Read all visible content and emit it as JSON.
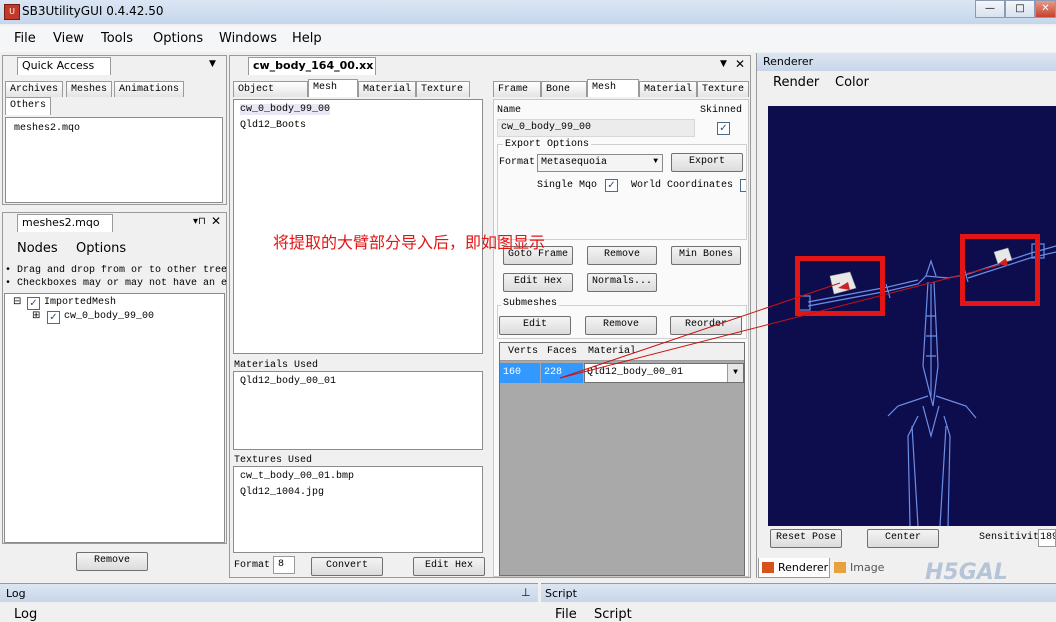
{
  "window": {
    "title": "SB3UtilityGUI 0.4.42.50"
  },
  "menu": {
    "items": [
      "File",
      "View",
      "Tools",
      "Options",
      "Windows",
      "Help"
    ]
  },
  "quick_access": {
    "title": "Quick Access",
    "tabs": [
      "Archives",
      "Meshes",
      "Animations",
      "Others"
    ],
    "items": [
      "meshes2.mqo"
    ],
    "remove_label": "Remove"
  },
  "mqo_panel": {
    "title": "meshes2.mqo",
    "menu": [
      "Nodes",
      "Options"
    ],
    "help_lines": [
      "• Drag and drop from or to other tree",
      "• Checkboxes may or may not have an e"
    ],
    "tree": [
      {
        "label": "ImportedMesh",
        "toggle": "⊟"
      },
      {
        "label": "cw_0_body_99_00",
        "toggle": "⊞"
      }
    ]
  },
  "doc_tab": {
    "title": "cw_body_164_00.xx"
  },
  "editor_tabs": [
    "Object Tree",
    "Mesh",
    "Material",
    "Texture"
  ],
  "mesh_list": [
    "cw_0_body_99_00",
    "Qld12_Boots"
  ],
  "materials_used": {
    "label": "Materials Used",
    "items": [
      "Qld12_body_00_01"
    ]
  },
  "textures_used": {
    "label": "Textures Used",
    "items": [
      "cw_t_body_00_01.bmp",
      "Qld12_1004.jpg"
    ]
  },
  "bottom_bar": {
    "format_label": "Format",
    "format_value": "8",
    "convert_label": "Convert",
    "edit_hex_label": "Edit Hex"
  },
  "props_tabs": [
    "Frame",
    "Bone",
    "Mesh",
    "Material",
    "Texture"
  ],
  "props": {
    "name_label": "Name",
    "name_value": "cw_0_body_99_00",
    "skinned_label": "Skinned",
    "export_options_label": "Export Options",
    "format_label": "Format",
    "format_value": "Metasequoia",
    "export_label": "Export",
    "single_mqo_label": "Single Mqo",
    "world_coords_label": "World Coordinates",
    "goto_frame_label": "Goto Frame",
    "remove_label": "Remove",
    "min_bones_label": "Min Bones",
    "edit_hex_label": "Edit Hex",
    "normals_label": "Normals...",
    "submeshes_label": "Submeshes",
    "edit_label": "Edit",
    "remove2_label": "Remove",
    "reorder_label": "Reorder",
    "grid_headers": [
      "Verts",
      "Faces",
      "Material"
    ],
    "grid_row": {
      "verts": "160",
      "faces": "228",
      "material": "Qld12_body_00_01"
    }
  },
  "annotation": "将提取的大臂部分导入后，即如图显示",
  "renderer": {
    "title": "Renderer",
    "menu": [
      "Render",
      "Color"
    ],
    "reset_pose_label": "Reset Pose",
    "center_label": "Center",
    "sensitivity_label": "Sensitivit",
    "sensitivity_value": "189",
    "tabs": [
      "Renderer",
      "Image"
    ]
  },
  "log": {
    "title": "Log",
    "menu_item": "Log"
  },
  "script": {
    "title": "Script",
    "menu": [
      "File",
      "Script"
    ]
  },
  "watermark": "H5GAL",
  "colors": {
    "accent": "#3399ff",
    "annotation_red": "#e31515",
    "render_bg": "#0d0d4e",
    "skeleton": "#6b8fe6"
  }
}
